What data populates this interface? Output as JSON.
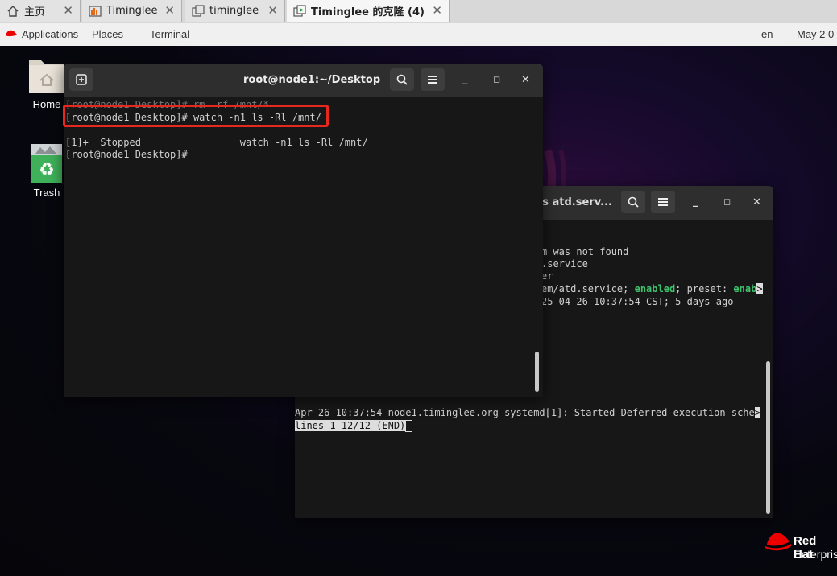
{
  "vm_tabs": [
    {
      "label": "主页",
      "icon": "home-icon"
    },
    {
      "label": "Timinglee",
      "icon": "vm-icon"
    },
    {
      "label": "timinglee",
      "icon": "vm-clone-icon"
    },
    {
      "label": "Timinglee 的克隆 (4)",
      "icon": "vm-running-icon",
      "active": true
    }
  ],
  "topbar": {
    "applications": "Applications",
    "places": "Places",
    "terminal": "Terminal",
    "lang": "en",
    "clock": "May 2  0"
  },
  "desktop": {
    "home_label": "Home",
    "trash_label": "Trash",
    "brand_line1": "Red Hat",
    "brand_line2": "Enterprise"
  },
  "front_terminal": {
    "title": "root@node1:~/Desktop",
    "lines": [
      "[root@node1 Desktop]# rm -rf /mnt/*",
      "[root@node1 Desktop]# watch -n1 ls -Rl /mnt/",
      "",
      "[1]+  Stopped                 watch -n1 ls -Rl /mnt/",
      "[root@node1 Desktop]#"
    ]
  },
  "back_terminal": {
    "title": "us atd.serv...",
    "lines": [
      "m was not found",
      ".service",
      "er",
      "em/atd.service; ",
      "25-04-26 10:37:54 CST; 5 days ago"
    ],
    "enabled_word": "enabled",
    "preset_text": "; preset: ",
    "enab_word": "enab",
    "log_line": "Apr 26 10:37:54 node1.timinglee.org systemd[1]: Started Deferred execution sche",
    "pager_status": "lines 1-12/12 (END)"
  },
  "colors": {
    "highlight": "#e8281e",
    "enabled_green": "#3ec46d",
    "redhat_red": "#ee0000"
  }
}
